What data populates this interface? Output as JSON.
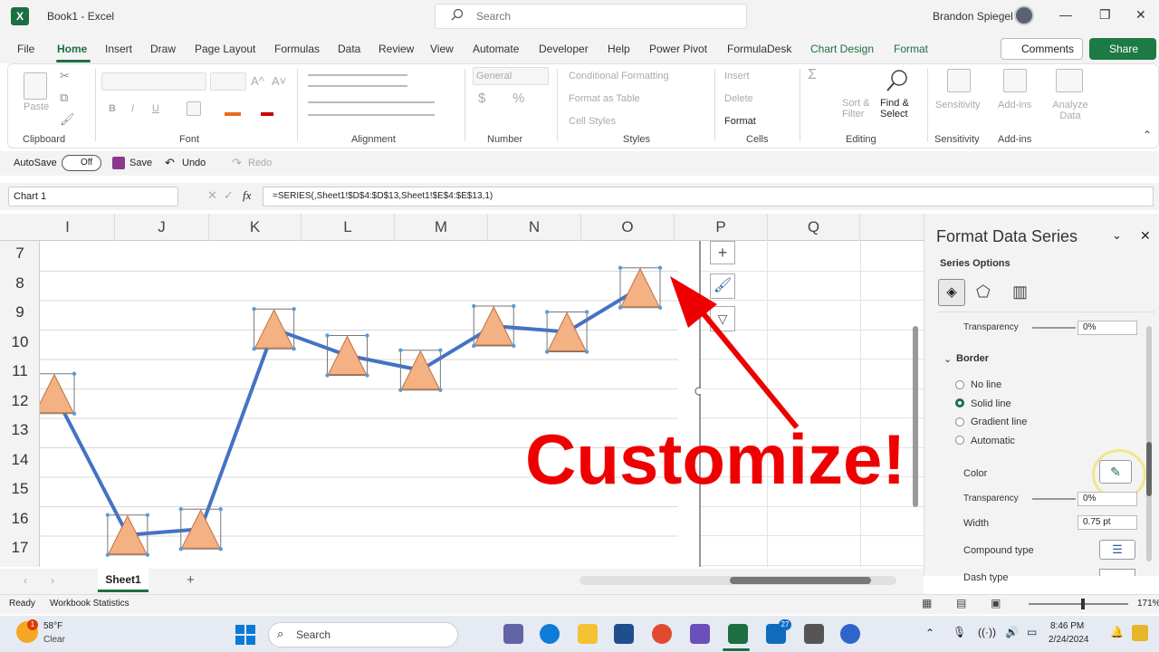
{
  "app": {
    "title": "Book1 - Excel",
    "search_placeholder": "Search",
    "user": "Brandon Spiegel"
  },
  "tabs": [
    "File",
    "Home",
    "Insert",
    "Draw",
    "Page Layout",
    "Formulas",
    "Data",
    "Review",
    "View",
    "Automate",
    "Developer",
    "Help",
    "Power Pivot",
    "FormulaDesk",
    "Chart Design",
    "Format"
  ],
  "buttons": {
    "comments": "Comments",
    "share": "Share"
  },
  "ribbon": {
    "clipboard": {
      "label": "Clipboard",
      "paste": "Paste"
    },
    "font": {
      "label": "Font",
      "bold": "B",
      "italic": "I",
      "underline": "U",
      "grow": "A^",
      "shrink": "A˅"
    },
    "alignment": {
      "label": "Alignment"
    },
    "number": {
      "label": "Number",
      "format": "General",
      "currency": "$",
      "percent": "%"
    },
    "styles": {
      "label": "Styles",
      "cond": "Conditional Formatting",
      "table": "Format as Table",
      "cell": "Cell Styles"
    },
    "cells": {
      "label": "Cells",
      "insert": "Insert",
      "delete": "Delete",
      "format": "Format"
    },
    "editing": {
      "label": "Editing",
      "sort": "Sort & Filter",
      "find": "Find & Select"
    },
    "sensitivity": {
      "label": "Sensitivity",
      "btn": "Sensitivity"
    },
    "addins": {
      "label": "Add-ins",
      "btn": "Add-ins"
    },
    "analyze": {
      "btn": "Analyze Data"
    }
  },
  "qat": {
    "autosave": "AutoSave",
    "toggle": "Off",
    "save": "Save",
    "undo": "Undo",
    "redo": "Redo"
  },
  "formula": {
    "namebox": "Chart 1",
    "fx": "fx",
    "value": "=SERIES(,Sheet1!$D$4:$D$13,Sheet1!$E$4:$E$13,1)"
  },
  "columns": [
    "I",
    "J",
    "K",
    "L",
    "M",
    "N",
    "O",
    "P",
    "Q"
  ],
  "rows": [
    "7",
    "8",
    "9",
    "10",
    "11",
    "12",
    "13",
    "14",
    "15",
    "16",
    "17"
  ],
  "chart_data": {
    "type": "line",
    "x": [
      1,
      2,
      3,
      4,
      5,
      6,
      7,
      8,
      9
    ],
    "series": [
      {
        "values": [
          11.7,
          16.5,
          16.3,
          9.5,
          10.4,
          10.9,
          9.4,
          9.6,
          8.1
        ],
        "color": "#4472c4",
        "marker": "triangle",
        "marker_color": "#f4b183"
      }
    ],
    "note_axis": "marker positions read against worksheet row numbers"
  },
  "panel": {
    "title": "Format Data Series",
    "series_options": "Series Options",
    "transparency_label": "Transparency",
    "transparency_value": "0%",
    "border_label": "Border",
    "no_line": "No line",
    "solid_line": "Solid line",
    "gradient_line": "Gradient line",
    "automatic": "Automatic",
    "color_label": "Color",
    "transparency2_value": "0%",
    "width_label": "Width",
    "width_value": "0.75 pt",
    "compound_label": "Compound type",
    "dash_label": "Dash type"
  },
  "sheet": {
    "name": "Sheet1",
    "add": "+"
  },
  "status": {
    "ready": "Ready",
    "stats": "Workbook Statistics",
    "zoom": "171%"
  },
  "taskbar": {
    "weather": "58°F",
    "weather_desc": "Clear",
    "search": "Search",
    "time": "8:46 PM",
    "date": "2/24/2024",
    "badge1": "1",
    "badge2": "27"
  },
  "overlay": {
    "text": "Customize!"
  }
}
